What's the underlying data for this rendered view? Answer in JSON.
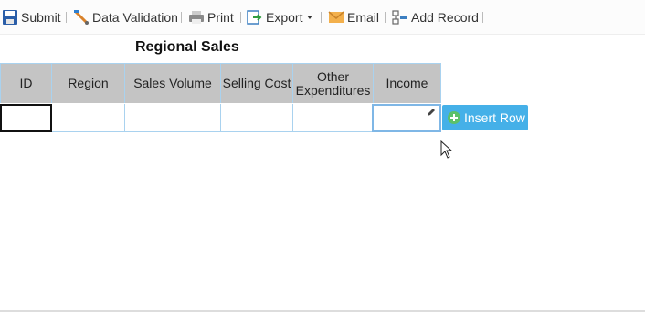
{
  "toolbar": {
    "submit": "Submit",
    "data_validation": "Data Validation",
    "print": "Print",
    "export": "Export",
    "email": "Email",
    "add_record": "Add Record"
  },
  "sheet": {
    "title": "Regional Sales",
    "columns": [
      "ID",
      "Region",
      "Sales Volume",
      "Selling Cost",
      "Other Expenditures",
      "Income"
    ],
    "row": [
      "",
      "",
      "",
      "",
      "",
      ""
    ]
  },
  "insert_row_button": "Insert Row",
  "colors": {
    "header_bg": "#c4c4c4",
    "grid_border": "#a9d2ef",
    "button_bg": "#45b0e8",
    "button_plus": "#5cc16a"
  }
}
